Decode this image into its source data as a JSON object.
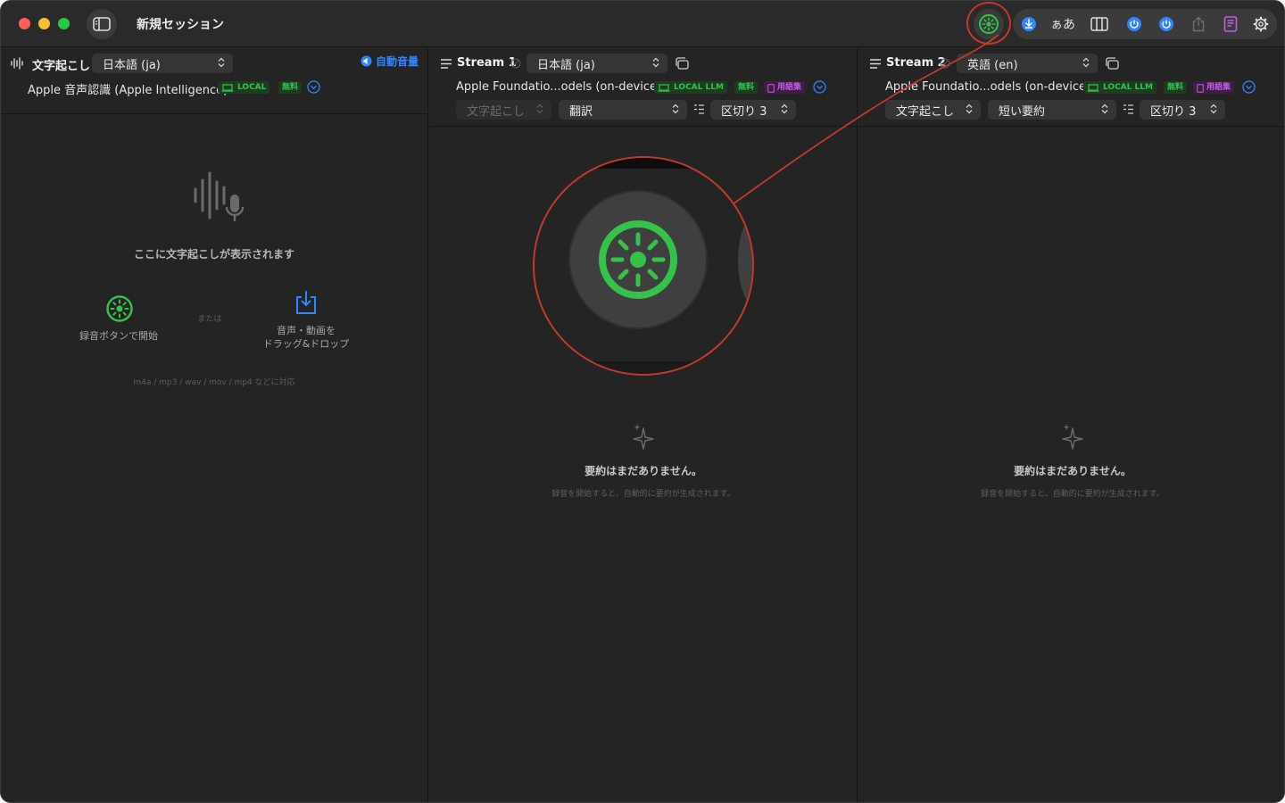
{
  "window": {
    "title": "新規セッション"
  },
  "toolbar": {
    "font_label": "ぁあ"
  },
  "transcription": {
    "header_label": "文字起こし",
    "language": "日本語 (ja)",
    "auto_volume": "自動音量",
    "engine": "Apple 音声認識 (Apple Intelligence)",
    "badges": {
      "local": "LOCAL",
      "free": "無料"
    },
    "empty_title": "ここに文字起こしが表示されます",
    "record_hint": "録音ボタンで開始",
    "or": "または",
    "drop_hint_line1": "音声・動画を",
    "drop_hint_line2": "ドラッグ&ドロップ",
    "formats": "m4a / mp3 / wav / mov / mp4 などに対応"
  },
  "streams": [
    {
      "title": "Stream 1",
      "language": "日本語 (ja)",
      "model": "Apple Foundatio...odels (on-device)",
      "badges": {
        "local": "LOCAL LLM",
        "free": "無料",
        "glossary": "用語集"
      },
      "source": "文字起こし",
      "mode": "翻訳",
      "segment": "区切り 3",
      "empty_title": "要約はまだありません。",
      "empty_sub": "録音を開始すると、自動的に要約が生成されます。"
    },
    {
      "title": "Stream 2",
      "language": "英語 (en)",
      "model": "Apple Foundatio...odels (on-device)",
      "badges": {
        "local": "LOCAL LLM",
        "free": "無料",
        "glossary": "用語集"
      },
      "source": "文字起こし",
      "mode": "短い要約",
      "segment": "区切り 3",
      "empty_title": "要約はまだありません。",
      "empty_sub": "録音を開始すると、自動的に要約が生成されます。"
    }
  ],
  "colors": {
    "accent_green": "#35c24a",
    "accent_blue": "#2f86ff",
    "annotation_red": "#c0392b",
    "glossary_purple": "#c060e0"
  },
  "icons": [
    "sidebar-icon",
    "record-icon",
    "download-icon",
    "font-icon",
    "columns-icon",
    "power-icon",
    "share-icon",
    "book-icon",
    "gear-icon",
    "waveform-icon",
    "speaker-icon",
    "chevron-updown-icon",
    "chevron-down-circle-icon",
    "list-icon",
    "copy-icon",
    "sparkle-icon",
    "mic-wave-icon",
    "import-icon"
  ]
}
